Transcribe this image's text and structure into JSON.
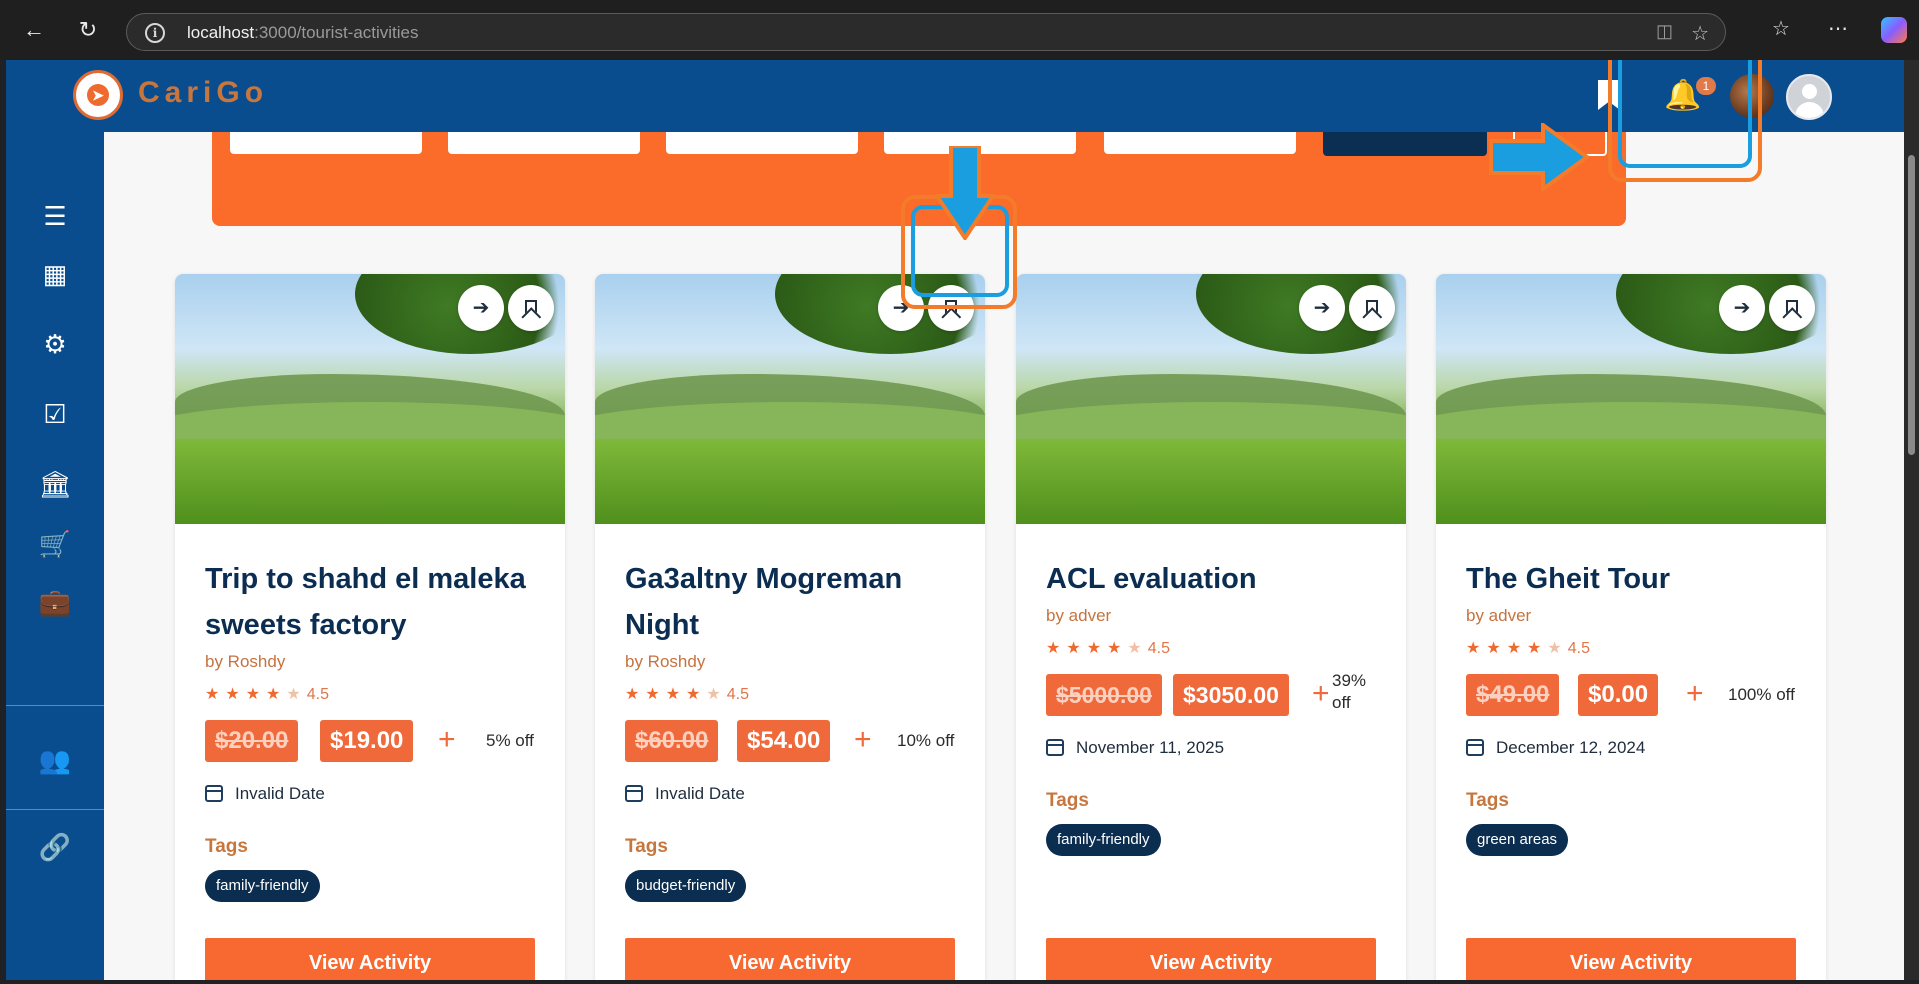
{
  "browser": {
    "url_host": "localhost",
    "url_path": ":3000/tourist-activities"
  },
  "header": {
    "brand": "CariGo",
    "notification_count": "1"
  },
  "colors": {
    "primary": "#0a4d8f",
    "accent": "#f76930",
    "dark_navy": "#0b2d52"
  },
  "sidebar": {
    "icons": [
      "menu-icon",
      "dashboard-icon",
      "tour-guide-icon",
      "checklist-icon",
      "museum-icon",
      "cart-icon",
      "luggage-icon",
      "user-settings-icon",
      "link-icon"
    ]
  },
  "cards": [
    {
      "title": "Trip to shahd el maleka sweets factory",
      "author": "by Roshdy",
      "rating": "4.5",
      "old_price": "$20.00",
      "new_price": "$19.00",
      "discount": "5% off",
      "date": "Invalid Date",
      "tags_label": "Tags",
      "tag": "family-friendly",
      "button": "View Activity"
    },
    {
      "title": "Ga3altny Mogreman Night",
      "author": "by Roshdy",
      "rating": "4.5",
      "old_price": "$60.00",
      "new_price": "$54.00",
      "discount": "10% off",
      "date": "Invalid Date",
      "tags_label": "Tags",
      "tag": "budget-friendly",
      "button": "View Activity"
    },
    {
      "title": "ACL evaluation",
      "author": "by adver",
      "rating": "4.5",
      "old_price": "$5000.00",
      "new_price": "$3050.00",
      "discount": "39% off",
      "date": "November 11, 2025",
      "tags_label": "Tags",
      "tag": "family-friendly",
      "button": "View Activity"
    },
    {
      "title": "The Gheit Tour",
      "author": "by adver",
      "rating": "4.5",
      "old_price": "$49.00",
      "new_price": "$0.00",
      "discount": "100% off",
      "date": "December 12, 2024",
      "tags_label": "Tags",
      "tag": "green areas",
      "button": "View Activity"
    }
  ]
}
